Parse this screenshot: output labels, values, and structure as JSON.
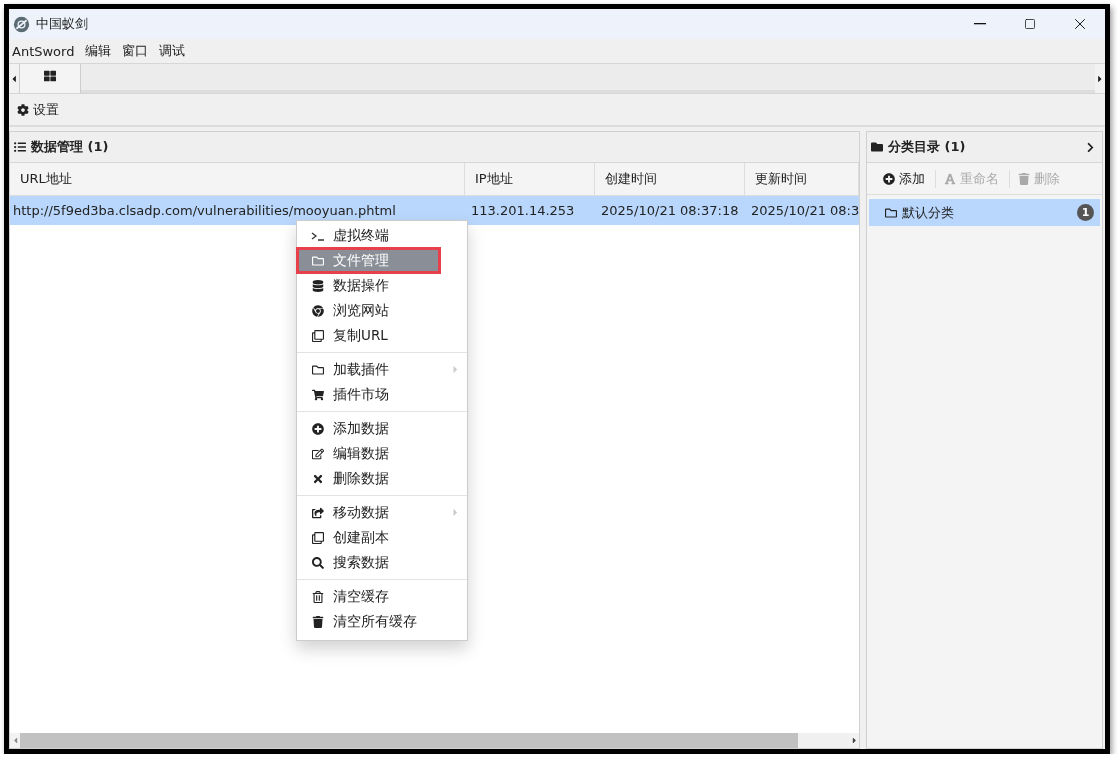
{
  "window": {
    "title": "中国蚁剑"
  },
  "menu_bar": [
    "AntSword",
    "编辑",
    "窗口",
    "调试"
  ],
  "tabs": [
    {
      "kind": "grid",
      "selected": true
    }
  ],
  "toolbar": {
    "settings": "设置"
  },
  "data_panel": {
    "title": "数据管理 (1)",
    "columns": [
      "URL地址",
      "IP地址",
      "创建时间",
      "更新时间"
    ],
    "rows": [
      {
        "selected": true,
        "cells": [
          "http://5f9ed3ba.clsadp.com/vulnerabilities/mooyuan.phtml",
          "113.201.14.253",
          "2025/10/21 08:37:18",
          "2025/10/21 08:3"
        ]
      }
    ]
  },
  "context_menu": [
    [
      {
        "label": "虚拟终端",
        "selected": false,
        "outlined": false,
        "submenu": false
      },
      {
        "label": "文件管理",
        "selected": true,
        "outlined": true,
        "submenu": false
      },
      {
        "label": "数据操作",
        "selected": false,
        "outlined": false,
        "submenu": false
      },
      {
        "label": "浏览网站",
        "selected": false,
        "outlined": false,
        "submenu": false
      },
      {
        "label": "复制URL",
        "selected": false,
        "outlined": false,
        "submenu": false
      }
    ],
    [
      {
        "label": "加载插件",
        "selected": false,
        "outlined": false,
        "submenu": true
      },
      {
        "label": "插件市场",
        "selected": false,
        "outlined": false,
        "submenu": false
      }
    ],
    [
      {
        "label": "添加数据",
        "selected": false,
        "outlined": false,
        "submenu": false
      },
      {
        "label": "编辑数据",
        "selected": false,
        "outlined": false,
        "submenu": false
      },
      {
        "label": "删除数据",
        "selected": false,
        "outlined": false,
        "submenu": false
      }
    ],
    [
      {
        "label": "移动数据",
        "selected": false,
        "outlined": false,
        "submenu": true
      },
      {
        "label": "创建副本",
        "selected": false,
        "outlined": false,
        "submenu": false
      },
      {
        "label": "搜索数据",
        "selected": false,
        "outlined": false,
        "submenu": false
      }
    ],
    [
      {
        "label": "清空缓存",
        "selected": false,
        "outlined": false,
        "submenu": false
      },
      {
        "label": "清空所有缓存",
        "selected": false,
        "outlined": false,
        "submenu": false
      }
    ]
  ],
  "category_panel": {
    "title": "分类目录 (1)",
    "buttons": [
      {
        "label": "添加",
        "disabled": false
      },
      {
        "label": "重命名",
        "disabled": true
      },
      {
        "label": "删除",
        "disabled": true
      }
    ],
    "items": [
      {
        "label": "默认分类",
        "count": "1",
        "selected": true
      }
    ]
  }
}
